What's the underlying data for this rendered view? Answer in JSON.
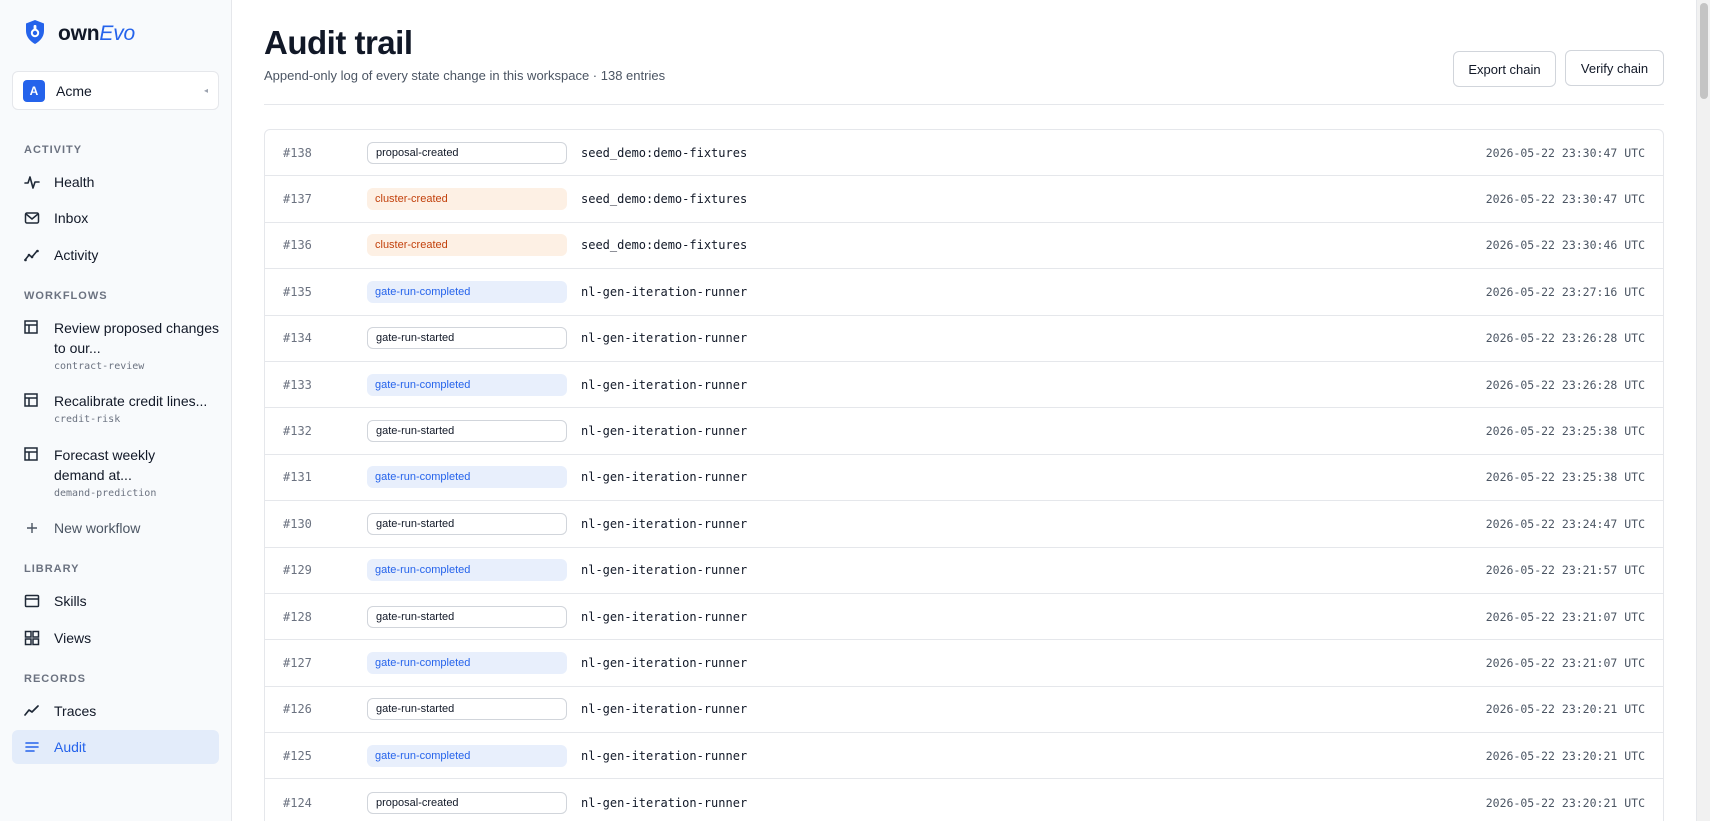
{
  "brand": {
    "name_prefix": "own",
    "name_suffix": "Evo"
  },
  "workspace": {
    "initial": "A",
    "name": "Acme"
  },
  "sidebar": {
    "activity_label": "ACTIVITY",
    "activity": [
      {
        "label": "Health",
        "icon": "pulse-icon"
      },
      {
        "label": "Inbox",
        "icon": "mail-icon"
      },
      {
        "label": "Activity",
        "icon": "trend-icon"
      }
    ],
    "workflows_label": "WORKFLOWS",
    "workflows": [
      {
        "title": "Review proposed changes to our...",
        "slug": "contract-review"
      },
      {
        "title": "Recalibrate credit lines...",
        "slug": "credit-risk"
      },
      {
        "title": "Forecast weekly demand at...",
        "slug": "demand-prediction"
      }
    ],
    "new_workflow": "New workflow",
    "library_label": "LIBRARY",
    "library": [
      {
        "label": "Skills",
        "icon": "card-icon"
      },
      {
        "label": "Views",
        "icon": "grid-icon"
      }
    ],
    "records_label": "RECORDS",
    "records": [
      {
        "label": "Traces",
        "icon": "trace-icon"
      },
      {
        "label": "Audit",
        "icon": "list-icon",
        "active": true
      }
    ]
  },
  "page": {
    "title": "Audit trail",
    "subtitle": "Append-only log of every state change in this workspace · 138 entries",
    "export_label": "Export chain",
    "verify_label": "Verify chain"
  },
  "entries": [
    {
      "seq": "#138",
      "event": "proposal-created",
      "kind": "neutral",
      "actor": "seed_demo:demo-fixtures",
      "ts": "2026-05-22 23:30:47 UTC"
    },
    {
      "seq": "#137",
      "event": "cluster-created",
      "kind": "orange",
      "actor": "seed_demo:demo-fixtures",
      "ts": "2026-05-22 23:30:47 UTC"
    },
    {
      "seq": "#136",
      "event": "cluster-created",
      "kind": "orange",
      "actor": "seed_demo:demo-fixtures",
      "ts": "2026-05-22 23:30:46 UTC"
    },
    {
      "seq": "#135",
      "event": "gate-run-completed",
      "kind": "blue",
      "actor": "nl-gen-iteration-runner",
      "ts": "2026-05-22 23:27:16 UTC"
    },
    {
      "seq": "#134",
      "event": "gate-run-started",
      "kind": "neutral",
      "actor": "nl-gen-iteration-runner",
      "ts": "2026-05-22 23:26:28 UTC"
    },
    {
      "seq": "#133",
      "event": "gate-run-completed",
      "kind": "blue",
      "actor": "nl-gen-iteration-runner",
      "ts": "2026-05-22 23:26:28 UTC"
    },
    {
      "seq": "#132",
      "event": "gate-run-started",
      "kind": "neutral",
      "actor": "nl-gen-iteration-runner",
      "ts": "2026-05-22 23:25:38 UTC"
    },
    {
      "seq": "#131",
      "event": "gate-run-completed",
      "kind": "blue",
      "actor": "nl-gen-iteration-runner",
      "ts": "2026-05-22 23:25:38 UTC"
    },
    {
      "seq": "#130",
      "event": "gate-run-started",
      "kind": "neutral",
      "actor": "nl-gen-iteration-runner",
      "ts": "2026-05-22 23:24:47 UTC"
    },
    {
      "seq": "#129",
      "event": "gate-run-completed",
      "kind": "blue",
      "actor": "nl-gen-iteration-runner",
      "ts": "2026-05-22 23:21:57 UTC"
    },
    {
      "seq": "#128",
      "event": "gate-run-started",
      "kind": "neutral",
      "actor": "nl-gen-iteration-runner",
      "ts": "2026-05-22 23:21:07 UTC"
    },
    {
      "seq": "#127",
      "event": "gate-run-completed",
      "kind": "blue",
      "actor": "nl-gen-iteration-runner",
      "ts": "2026-05-22 23:21:07 UTC"
    },
    {
      "seq": "#126",
      "event": "gate-run-started",
      "kind": "neutral",
      "actor": "nl-gen-iteration-runner",
      "ts": "2026-05-22 23:20:21 UTC"
    },
    {
      "seq": "#125",
      "event": "gate-run-completed",
      "kind": "blue",
      "actor": "nl-gen-iteration-runner",
      "ts": "2026-05-22 23:20:21 UTC"
    },
    {
      "seq": "#124",
      "event": "proposal-created",
      "kind": "neutral",
      "actor": "nl-gen-iteration-runner",
      "ts": "2026-05-22 23:20:21 UTC"
    }
  ],
  "colors": {
    "accent": "#2563eb",
    "orange": "#c2410c",
    "active_bg": "#e3ecfa"
  }
}
